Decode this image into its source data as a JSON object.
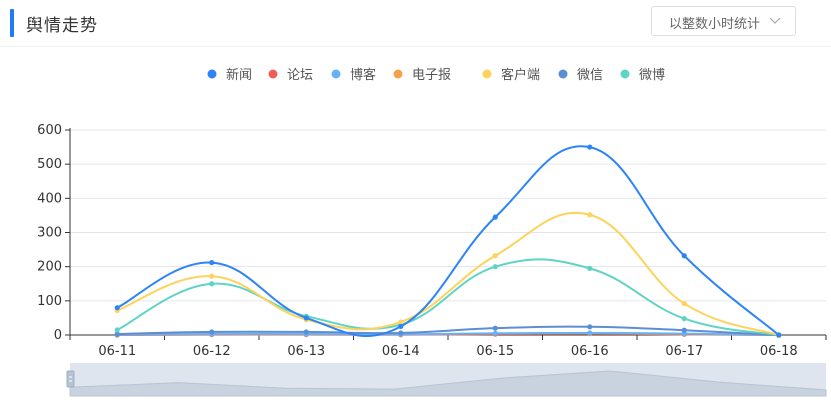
{
  "header": {
    "title": "舆情走势"
  },
  "stat_select": {
    "label": "以整数小时统计"
  },
  "colors": {
    "新闻": "#2e84f5",
    "论坛": "#ee5f5b",
    "博客": "#65b2f7",
    "电子报": "#f6a04d",
    "客户端": "#fdd35c",
    "微信": "#5c8ed4",
    "微博": "#5fd3c4"
  },
  "chart_data": {
    "type": "line",
    "smooth": true,
    "categories": [
      "06-11",
      "06-12",
      "06-13",
      "06-14",
      "06-15",
      "06-16",
      "06-17",
      "06-18"
    ],
    "ylim": [
      0,
      600
    ],
    "yticks": [
      0,
      100,
      200,
      300,
      400,
      500,
      600
    ],
    "grid": true,
    "legend_position": "top-center",
    "data_zoom": true,
    "series": [
      {
        "name": "新闻",
        "values": [
          80,
          212,
          50,
          25,
          345,
          550,
          232,
          0
        ]
      },
      {
        "name": "论坛",
        "values": [
          0,
          2,
          2,
          1,
          3,
          5,
          3,
          0
        ]
      },
      {
        "name": "博客",
        "values": [
          1,
          3,
          3,
          2,
          5,
          6,
          4,
          0
        ]
      },
      {
        "name": "电子报",
        "values": [
          0,
          1,
          1,
          1,
          3,
          4,
          2,
          0
        ]
      },
      {
        "name": "客户端",
        "values": [
          72,
          172,
          45,
          38,
          232,
          352,
          92,
          0
        ]
      },
      {
        "name": "微信",
        "values": [
          3,
          9,
          9,
          6,
          20,
          24,
          14,
          0
        ]
      },
      {
        "name": "微博",
        "values": [
          15,
          150,
          55,
          30,
          200,
          195,
          48,
          0
        ]
      }
    ]
  }
}
